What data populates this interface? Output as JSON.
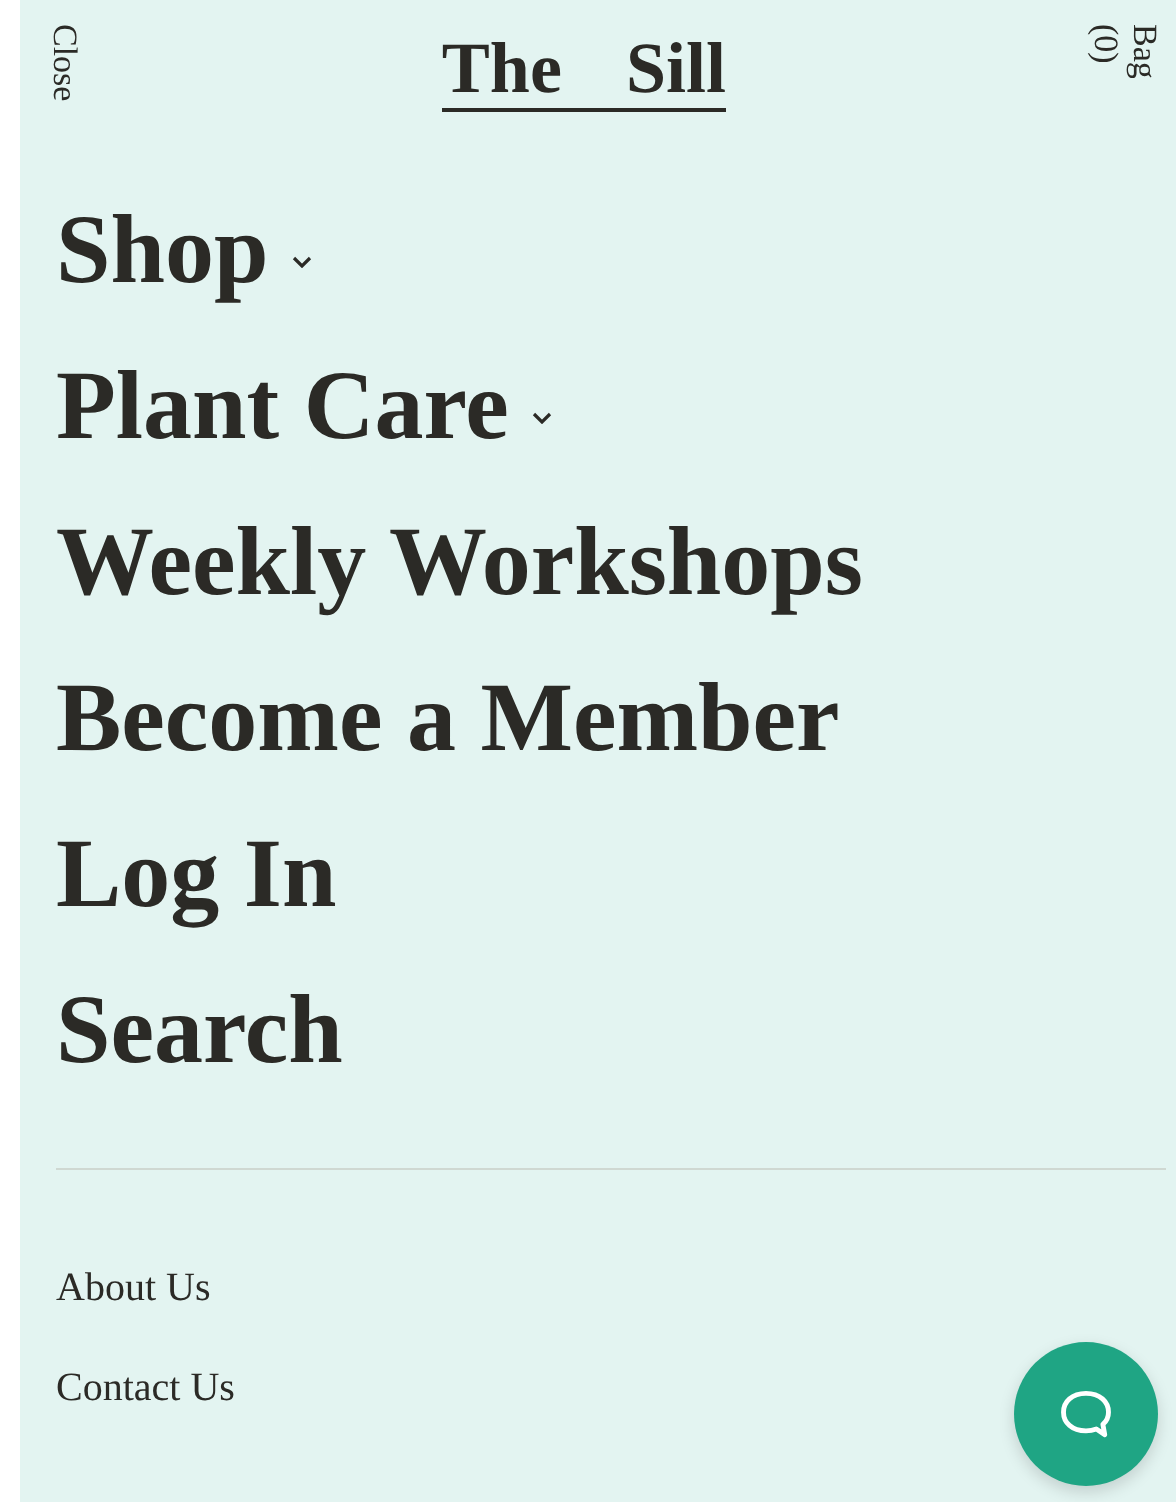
{
  "header": {
    "close": "Close",
    "logo": [
      "The",
      "Sill"
    ],
    "bag": [
      "Bag",
      "(0)"
    ]
  },
  "menu": [
    {
      "label": "Shop",
      "has_submenu": true
    },
    {
      "label": "Plant Care",
      "has_submenu": true
    },
    {
      "label": "Weekly Workshops",
      "has_submenu": false
    },
    {
      "label": "Become a Member",
      "has_submenu": false
    },
    {
      "label": "Log In",
      "has_submenu": false
    },
    {
      "label": "Search",
      "has_submenu": false
    }
  ],
  "footer_links": [
    "About Us",
    "Contact Us"
  ]
}
